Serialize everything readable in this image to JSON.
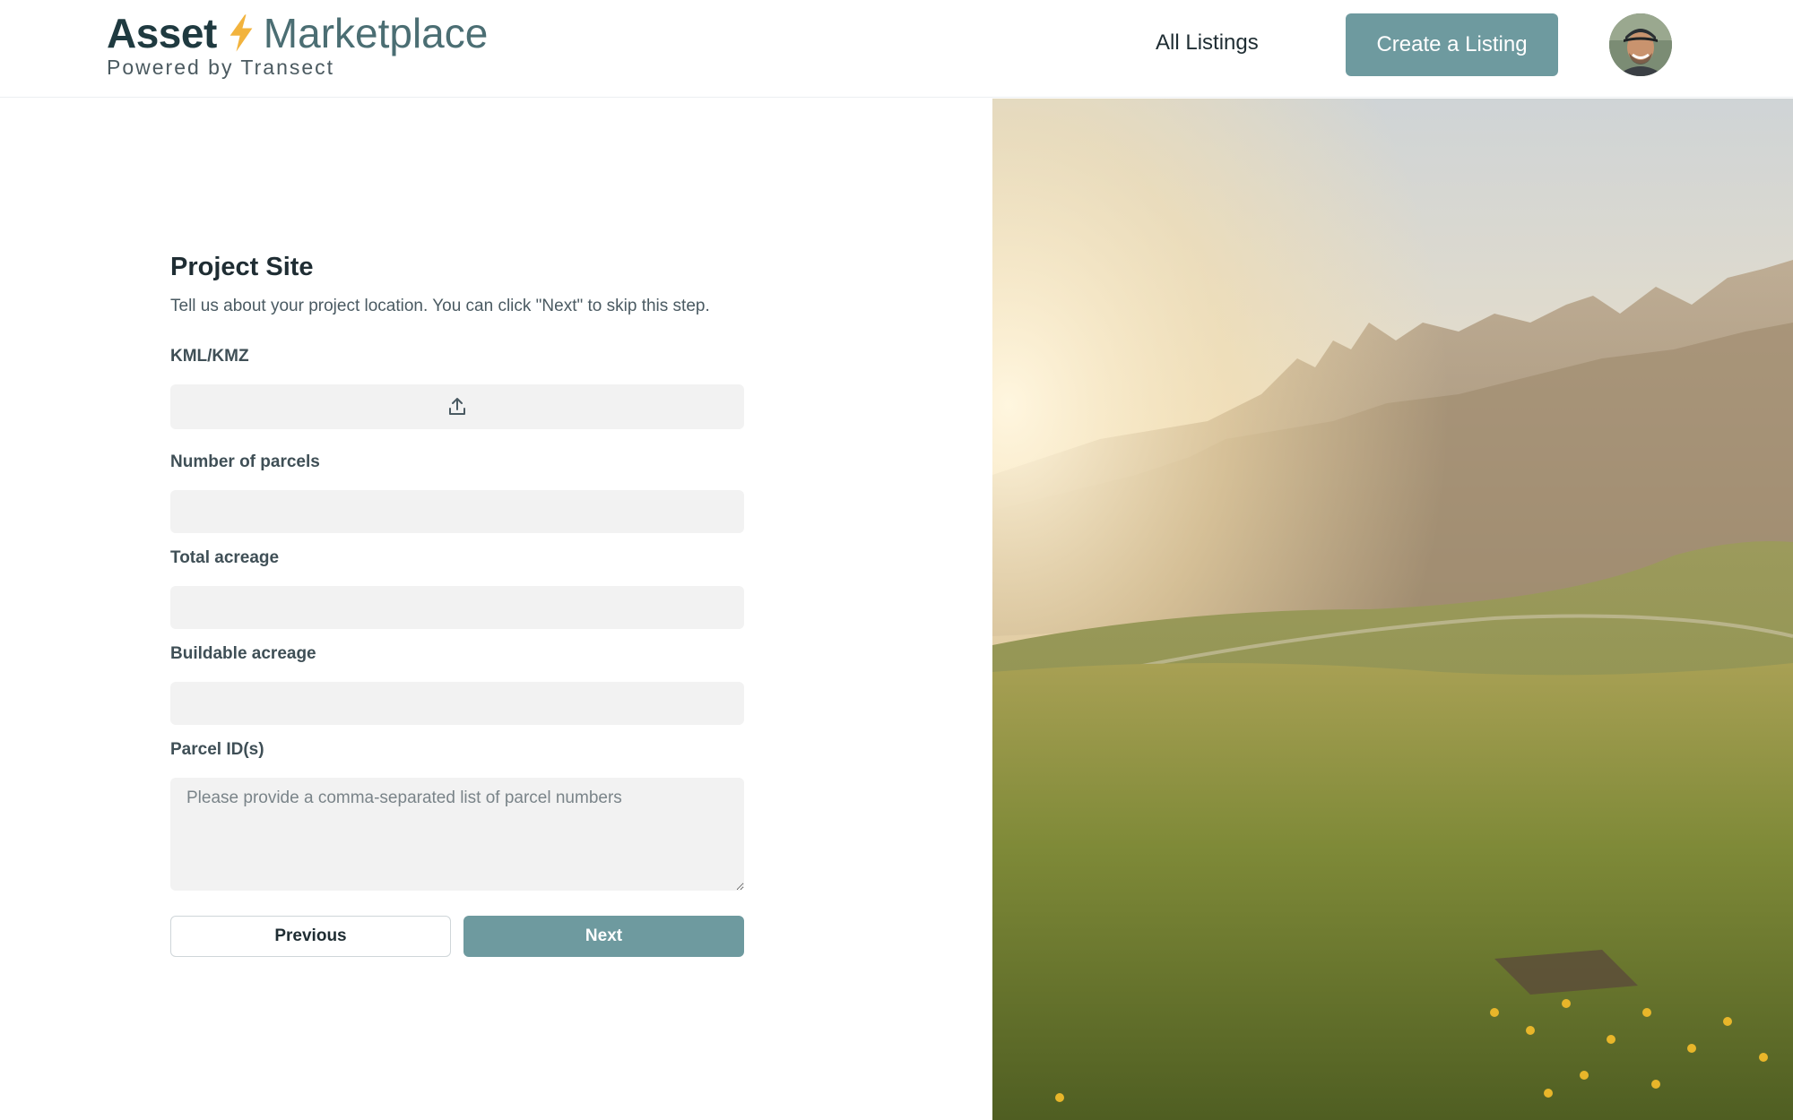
{
  "brand": {
    "name_bold": "Asset",
    "name_light": "Marketplace",
    "tagline": "Powered by Transect",
    "accent": "#6e9a9f",
    "bolt_color": "#f2b33d"
  },
  "nav": {
    "all_listings": "All Listings",
    "create_listing": "Create a Listing",
    "avatar_icon": "user-avatar"
  },
  "form": {
    "title": "Project Site",
    "description": "Tell us about your project location. You can click \"Next\" to skip this step.",
    "kml_label": "KML/KMZ",
    "upload_icon": "upload-icon",
    "parcels_label": "Number of parcels",
    "total_acreage_label": "Total acreage",
    "buildable_acreage_label": "Buildable acreage",
    "parcel_ids_label": "Parcel ID(s)",
    "parcel_ids_placeholder": "Please provide a comma-separated list of parcel numbers",
    "previous_label": "Previous",
    "next_label": "Next"
  },
  "hero": {
    "image_subject": "mountain meadow at sunset"
  }
}
